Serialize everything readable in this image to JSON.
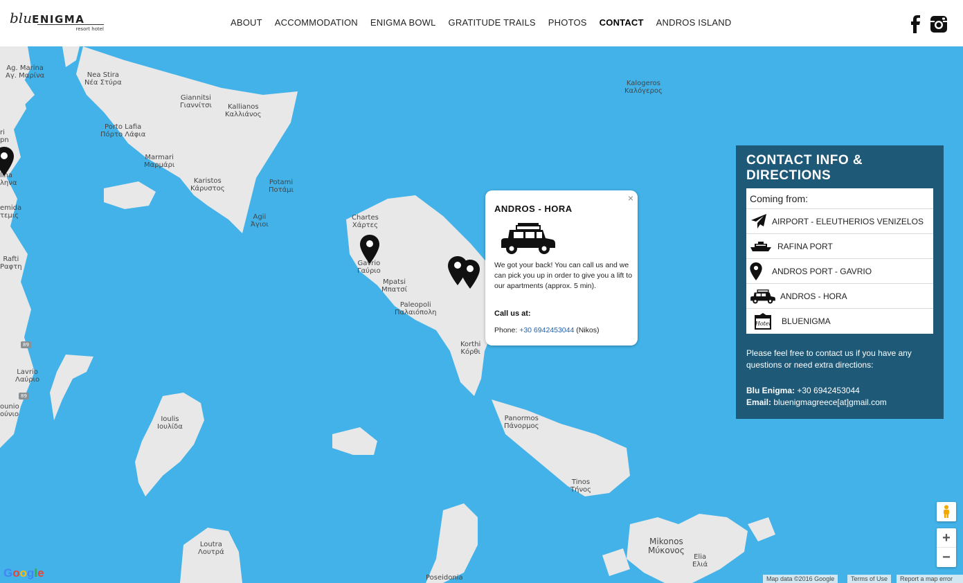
{
  "header": {
    "logo": {
      "script": "blu",
      "caps": "ENIGMA",
      "tagline": "resort hotel"
    },
    "nav": [
      {
        "label": "ABOUT",
        "active": false
      },
      {
        "label": "ACCOMMODATION",
        "active": false
      },
      {
        "label": "ENIGMA BOWL",
        "active": false
      },
      {
        "label": "GRATITUDE TRAILS",
        "active": false
      },
      {
        "label": "PHOTOS",
        "active": false
      },
      {
        "label": "CONTACT",
        "active": true
      },
      {
        "label": "ANDROS ISLAND",
        "active": false
      }
    ],
    "social": [
      "facebook-icon",
      "instagram-icon"
    ]
  },
  "map": {
    "places": [
      {
        "l1": "Ag. Marina",
        "l2": "Αγ. Μαρίνα"
      },
      {
        "l1": "Nea Stira",
        "l2": "Νέα Στύρα"
      },
      {
        "l1": "Giannitsi",
        "l2": "Γιαννίτσι"
      },
      {
        "l1": "Kallianos",
        "l2": "Καλλιάνος"
      },
      {
        "l1": "Porto Lafia",
        "l2": "Πόρτο Λάφια"
      },
      {
        "l1": "Marmari",
        "l2": "Μαρμάρι"
      },
      {
        "l1": "Karistos",
        "l2": "Κάρυστος"
      },
      {
        "l1": "Potami",
        "l2": "Ποτάμι"
      },
      {
        "l1": "Agii",
        "l2": "Άγιοι"
      },
      {
        "l1": "Chartes",
        "l2": "Χάρτες"
      },
      {
        "l1": "Gavrio",
        "l2": "Γαύριο"
      },
      {
        "l1": "Mpatsi",
        "l2": "Μπατσί"
      },
      {
        "l1": "Paleopoli",
        "l2": "Παλαιόπολη"
      },
      {
        "l1": "Korthi",
        "l2": "Κόρθι"
      },
      {
        "l1": "Kalogeros",
        "l2": "Καλόγερος"
      },
      {
        "l1": "Panormos",
        "l2": "Πάνορμος"
      },
      {
        "l1": "Tinos",
        "l2": "Τήνος"
      },
      {
        "l1": "Ioulis",
        "l2": "Ιουλίδα"
      },
      {
        "l1": "Loutra",
        "l2": "Λουτρά"
      },
      {
        "l1": "Lavrio",
        "l2": "Λαύριο"
      },
      {
        "l1": "Rafti",
        "l2": "Ραφτη"
      },
      {
        "l1": "Mikonos",
        "l2": "Μύκονος"
      },
      {
        "l1": "Elia",
        "l2": "Ελιά"
      },
      {
        "l1": "Poseidonia",
        "l2": ""
      },
      {
        "l1": "emida",
        "l2": "τεμις"
      },
      {
        "l1": "ounio",
        "l2": "ούνιο"
      },
      {
        "l1": "ri",
        "l2": "pn"
      },
      {
        "l1": "lina",
        "l2": "ληνα"
      }
    ],
    "road_badges": [
      "89",
      "89"
    ],
    "infowindow": {
      "close": "×",
      "title": "ANDROS - HORA",
      "body": "We got your back! You can call us and we can pick you up in order to give you a lift to our apartments (approx. 5 min).",
      "call_label": "Call us at:",
      "phone_label": "Phone:",
      "phone": "+30 6942453044",
      "phone_suffix": "(Nikos)"
    },
    "controls": {
      "zoom_in": "+",
      "zoom_out": "−"
    },
    "google_label": "Google",
    "attribution": [
      "Map data ©2016 Google",
      "Terms of Use",
      "Report a map error"
    ]
  },
  "panel": {
    "title": "CONTACT INFO & DIRECTIONS",
    "coming_from": "Coming from:",
    "items": [
      {
        "label": "AIRPORT - ELEUTHERIOS VENIZELOS",
        "icon": "airplane-icon"
      },
      {
        "label": "RAFINA PORT",
        "icon": "ferry-icon"
      },
      {
        "label": "ANDROS PORT - GAVRIO",
        "icon": "map-pin-icon"
      },
      {
        "label": "ANDROS - HORA",
        "icon": "car-icon"
      },
      {
        "label": "BLUENIGMA",
        "icon": "hotel-icon"
      }
    ],
    "note": "Please feel free to contact us if you have any questions or need extra directions:",
    "phone_label": "Blu Enigma:",
    "phone": "+30 6942453044",
    "email_label": "Email:",
    "email": "bluenigmagreece[at]gmail.com"
  },
  "colors": {
    "sea": "#42b2e8",
    "land": "#e8e8e8",
    "panel": "#1e5a78",
    "link": "#1f5fa8"
  }
}
